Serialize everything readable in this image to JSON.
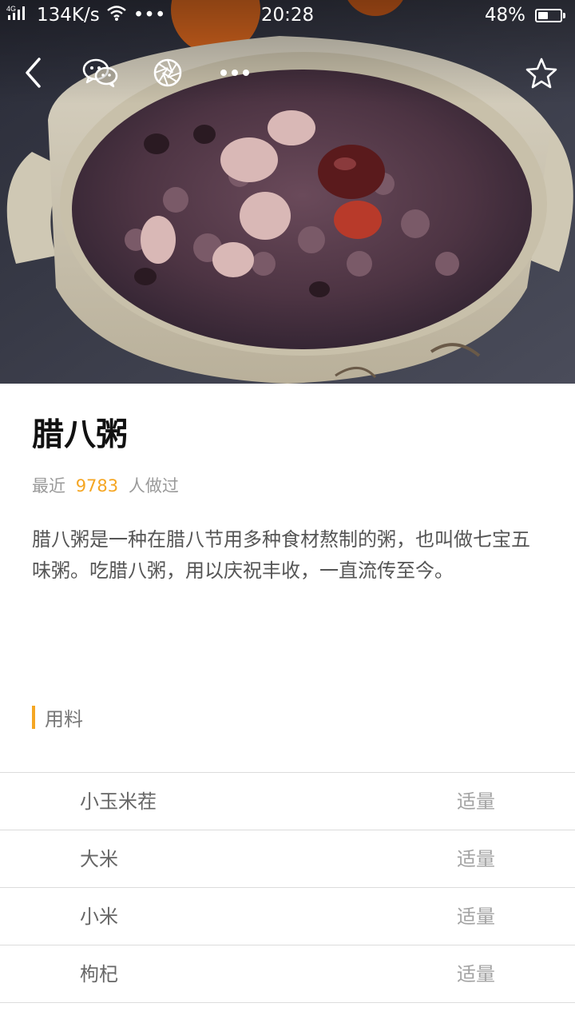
{
  "status_bar": {
    "network": "4G",
    "speed": "134K/s",
    "more_dots": "•••",
    "time": "20:28",
    "battery_percent_text": "48%",
    "battery_level": 0.48
  },
  "actions": {
    "back_icon": "chevron-left-icon",
    "wechat_icon": "wechat-icon",
    "moments_icon": "shutter-icon",
    "more_icon": "more-dots-icon",
    "favorite_icon": "star-outline-icon"
  },
  "recipe": {
    "title": "腊八粥",
    "made_prefix": "最近",
    "made_count": "9783",
    "made_suffix": "人做过",
    "description": "腊八粥是一种在腊八节用多种食材熬制的粥，也叫做七宝五味粥。吃腊八粥，用以庆祝丰收，一直流传至今。"
  },
  "ingredients_section": {
    "label": "用料",
    "accent_color": "#f5a623"
  },
  "ingredients": [
    {
      "name": "小玉米茬",
      "amount": "适量"
    },
    {
      "name": "大米",
      "amount": "适量"
    },
    {
      "name": "小米",
      "amount": "适量"
    },
    {
      "name": "枸杞",
      "amount": "适量"
    }
  ]
}
